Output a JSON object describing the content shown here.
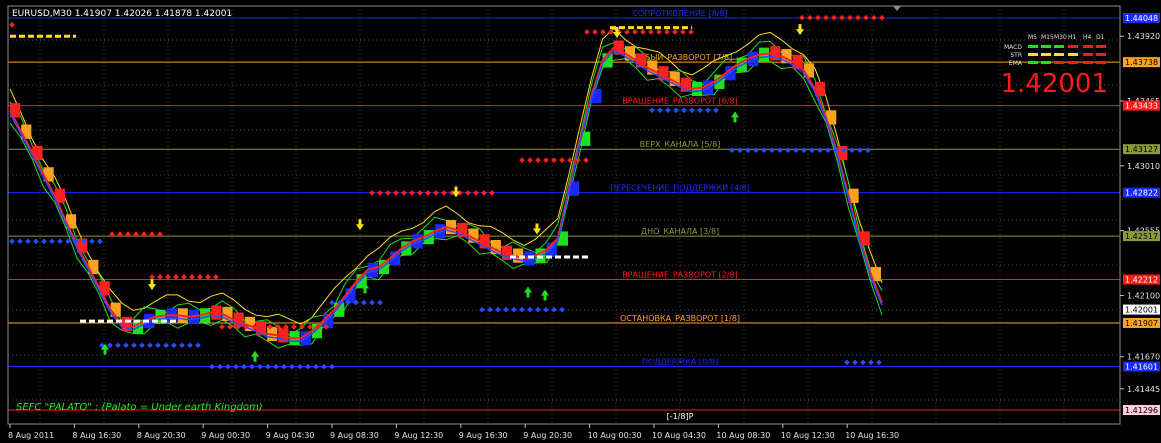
{
  "symbol_header": "EURUSD,M30  1.41907 1.42026 1.41878 1.42001",
  "big_price": "1.42001",
  "footer_text": "SEFC \"PALATO\" : (Palato = Under earth Kingdom)",
  "bottom_level_label": "[-1/8]P",
  "colors": {
    "background": "#000000",
    "grid": "#4a4a4a",
    "frame": "#8c8c8c",
    "big_price": "#ff1a1a",
    "bull_bar": "#1fe01f",
    "bear_bar": "#ffa21f",
    "bar_alt": "#1a2aff",
    "ma_red": "#ff2020",
    "ma_blue": "#2a4bff",
    "band_green": "#22dd22",
    "band_yellow": "#ffe020"
  },
  "indicator_panel": {
    "timeframes": [
      "M5",
      "M15",
      "M30",
      "H1",
      "H4",
      "D1"
    ],
    "rows": [
      {
        "name": "MACD",
        "states": [
          "green",
          "green",
          "green",
          "red",
          "red",
          "red"
        ]
      },
      {
        "name": "STR",
        "states": [
          "yellow",
          "yellow",
          "yellow",
          "yellow",
          "red",
          "red"
        ]
      },
      {
        "name": "EMA",
        "states": [
          "green",
          "green",
          "red",
          "red",
          "red",
          "red"
        ]
      }
    ]
  },
  "price_scale": [
    "1.43920",
    "1.43465",
    "1.43010",
    "1.42555",
    "1.42100",
    "1.41670",
    "1.41445"
  ],
  "price_scale_tags": [
    {
      "text": "1.44048",
      "value": 1.44048,
      "bg": "#1a2aff",
      "fg": "#ffffff"
    },
    {
      "text": "1.43738",
      "value": 1.43738,
      "bg": "#ffa21f",
      "fg": "#000000"
    },
    {
      "text": "1.43433",
      "value": 1.43433,
      "bg": "#ff1a1a",
      "fg": "#ffffff"
    },
    {
      "text": "1.43127",
      "value": 1.43127,
      "bg": "#8a9a3a",
      "fg": "#000000"
    },
    {
      "text": "1.42822",
      "value": 1.42822,
      "bg": "#1a2aff",
      "fg": "#ffffff"
    },
    {
      "text": "1.42517",
      "value": 1.42517,
      "bg": "#8a9a3a",
      "fg": "#000000"
    },
    {
      "text": "1.42212",
      "value": 1.42212,
      "bg": "#ff1a1a",
      "fg": "#ffffff"
    },
    {
      "text": "1.42001",
      "value": 1.42001,
      "bg": "#ffffff",
      "fg": "#000000"
    },
    {
      "text": "1.41907",
      "value": 1.41907,
      "bg": "#ffa21f",
      "fg": "#000000"
    },
    {
      "text": "1.41601",
      "value": 1.41601,
      "bg": "#1a2aff",
      "fg": "#ffffff"
    },
    {
      "text": "1.41296",
      "value": 1.41296,
      "bg": "#ffccdd",
      "fg": "#000000"
    }
  ],
  "time_axis": [
    "8 Aug 2011",
    "8 Aug 16:30",
    "8 Aug 20:30",
    "9 Aug 00:30",
    "9 Aug 04:30",
    "9 Aug 08:30",
    "9 Aug 12:30",
    "9 Aug 16:30",
    "9 Aug 20:30",
    "10 Aug 00:30",
    "10 Aug 04:30",
    "10 Aug 08:30",
    "10 Aug 12:30",
    "10 Aug 16:30"
  ],
  "murrey_levels": [
    {
      "value": 1.44048,
      "label": "СОПРОТИВЛЕНИЕ [8/8]",
      "color": "#1a2aff"
    },
    {
      "value": 1.43738,
      "label": "СЛАБЫЙ_РАЗВОРОТ [7/8]",
      "color": "#ffa21f"
    },
    {
      "value": 1.43433,
      "label": "ВРАЩЕНИЕ_РАЗВОРОТ [6/8]",
      "color": "#ff1a1a"
    },
    {
      "value": 1.43127,
      "label": "ВЕРХ_КАНАЛА [5/8]",
      "color": "#8a9a3a"
    },
    {
      "value": 1.42822,
      "label": "ПЕРЕСЕЧЕНИЕ_ПОДДЕРЖКИ [4/8]",
      "color": "#1a2aff"
    },
    {
      "value": 1.42517,
      "label": "ДНО_КАНАЛА [3/8]",
      "color": "#8a9a3a"
    },
    {
      "value": 1.42212,
      "label": "ВРАЩЕНИЕ_РАЗВОРОТ [2/8]",
      "color": "#ff1a1a"
    },
    {
      "value": 1.41907,
      "label": "ОСТАНОВКА_РАЗВОРОТ [1/8]",
      "color": "#ffa21f"
    },
    {
      "value": 1.41601,
      "label": "ПОДДЕРЖКА [0/8]",
      "color": "#1a2aff"
    },
    {
      "value": 1.41296,
      "label": "",
      "color": "#ff1a1a"
    }
  ],
  "price_path": [
    1.434,
    1.4325,
    1.431,
    1.4295,
    1.428,
    1.4262,
    1.4245,
    1.423,
    1.4215,
    1.42,
    1.419,
    1.4188,
    1.4192,
    1.4195,
    1.4196,
    1.4196,
    1.4195,
    1.4196,
    1.4198,
    1.4197,
    1.4193,
    1.419,
    1.4187,
    1.4183,
    1.4182,
    1.418,
    1.418,
    1.4185,
    1.4192,
    1.42,
    1.421,
    1.422,
    1.4228,
    1.423,
    1.4236,
    1.4243,
    1.4248,
    1.4251,
    1.4255,
    1.4258,
    1.4256,
    1.4252,
    1.4248,
    1.4244,
    1.424,
    1.4238,
    1.4236,
    1.4238,
    1.4242,
    1.425,
    1.4285,
    1.432,
    1.435,
    1.4375,
    1.4384,
    1.438,
    1.4375,
    1.437,
    1.4366,
    1.4362,
    1.4358,
    1.4355,
    1.4356,
    1.436,
    1.4366,
    1.4372,
    1.4376,
    1.4379,
    1.438,
    1.4378,
    1.4374,
    1.4368,
    1.4355,
    1.4335,
    1.431,
    1.428,
    1.425,
    1.4225,
    1.4205
  ]
}
